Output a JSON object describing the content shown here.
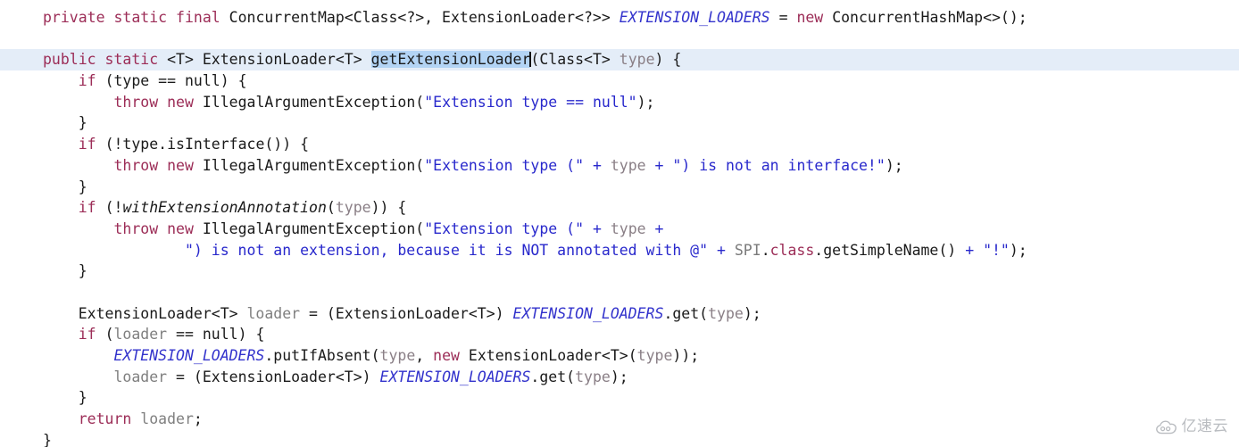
{
  "editor": {
    "background_color": "#ffffff",
    "current_line_highlight_color": "#e4edf8",
    "selection_color": "#b3d4f5",
    "colors": {
      "keyword": "#9c2d57",
      "string": "#2828cc",
      "static_field": "#3333cc",
      "parameter": "#8a7f86",
      "local_variable": "#7f7f7f",
      "plain_text": "#1a1a1a",
      "static_ref": "#7a7a7a"
    },
    "language": "Java"
  },
  "code": {
    "line1": {
      "kw_private": "private",
      "kw_static": "static",
      "kw_final": "final",
      "type_map": "ConcurrentMap<Class<?>, ExtensionLoader<?>>",
      "field": "EXTENSION_LOADERS",
      "equals": "=",
      "kw_new": "new",
      "ctor": "ConcurrentHashMap<>();"
    },
    "line3": {
      "kw_public": "public",
      "kw_static": "static",
      "generic": "<T>",
      "return_type": "ExtensionLoader<T>",
      "method_name": "getExtensionLoader",
      "open_paren": "(",
      "param_type": "Class<T>",
      "param_name": "type",
      "tail": ") {"
    },
    "line4": {
      "kw_if": "if",
      "cond": "(type == null) {"
    },
    "line5": {
      "kw_throw": "throw",
      "kw_new": "new",
      "exception": "IllegalArgumentException(",
      "message": "\"Extension type == null\"",
      "tail": ");"
    },
    "line6": {
      "brace": "}"
    },
    "line7": {
      "kw_if": "if",
      "cond": "(!type.isInterface()) {"
    },
    "line8": {
      "kw_throw": "throw",
      "kw_new": "new",
      "exception": "IllegalArgumentException(",
      "message_a": "\"Extension type (\"",
      "plus1": "+",
      "param": "type",
      "plus2": "+",
      "message_b": "\") is not an interface!\"",
      "tail": ");"
    },
    "line9": {
      "brace": "}"
    },
    "line10": {
      "kw_if": "if",
      "open": "(!",
      "method": "withExtensionAnnotation",
      "arg_open": "(",
      "param": "type",
      "tail": ")) {"
    },
    "line11": {
      "kw_throw": "throw",
      "kw_new": "new",
      "exception": "IllegalArgumentException(",
      "message_a": "\"Extension type (\"",
      "plus1": "+",
      "param": "type",
      "plus2": "+"
    },
    "line12": {
      "message_b": "\") is not an extension, because it is NOT annotated with @\"",
      "plus1": "+",
      "static_ref": "SPI",
      "dot": ".",
      "kw_class": "class",
      "call": ".getSimpleName()",
      "plus2": "+",
      "message_c": "\"!\"",
      "tail": ");"
    },
    "line13": {
      "brace": "}"
    },
    "line14": {
      "blank": " "
    },
    "line15": {
      "type": "ExtensionLoader<T>",
      "var": "loader",
      "equals": "=",
      "cast": "(ExtensionLoader<T>)",
      "field": "EXTENSION_LOADERS",
      "call": ".get(",
      "param": "type",
      "tail": ");"
    },
    "line16": {
      "kw_if": "if",
      "open": "(",
      "var": "loader",
      "cond": "== null) {"
    },
    "line17": {
      "field": "EXTENSION_LOADERS",
      "call": ".putIfAbsent(",
      "param1": "type",
      "comma": ", ",
      "kw_new": "new",
      "ctor": "ExtensionLoader<T>(",
      "param2": "type",
      "tail": "));"
    },
    "line18": {
      "var": "loader",
      "equals": "=",
      "cast": "(ExtensionLoader<T>)",
      "field": "EXTENSION_LOADERS",
      "call": ".get(",
      "param": "type",
      "tail": ");"
    },
    "line19": {
      "brace": "}"
    },
    "line20": {
      "kw_return": "return",
      "var": "loader",
      "semi": ";"
    },
    "line21": {
      "brace": "}"
    }
  },
  "watermark": {
    "text": "亿速云",
    "icon": "cloud-icon",
    "color": "#b9bcc0"
  }
}
